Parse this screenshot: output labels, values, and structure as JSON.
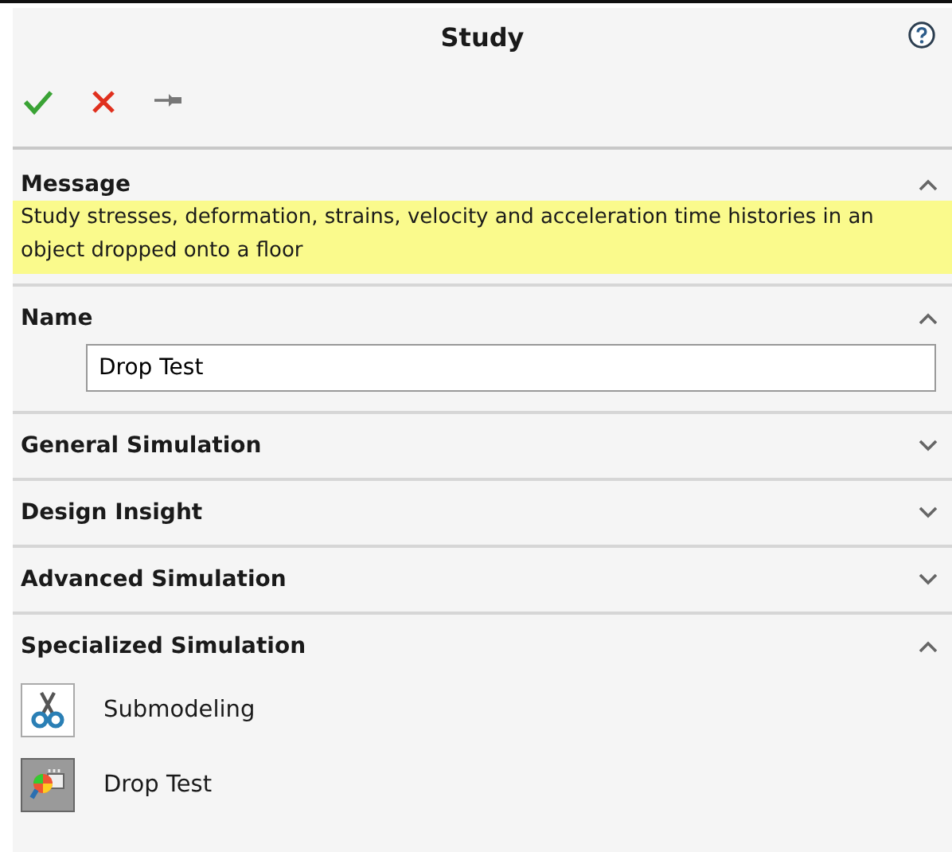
{
  "title": "Study",
  "toolbar": [
    {
      "kind": "ok"
    },
    {
      "kind": "cancel"
    },
    {
      "kind": "pin"
    }
  ],
  "sections": [
    {
      "title": "Message",
      "expanded": true,
      "kind": "message",
      "text": "Study stresses, deformation, strains, velocity and acceleration time histories in an object dropped onto a floor"
    },
    {
      "title": "Name",
      "expanded": true,
      "kind": "name",
      "value": "Drop Test"
    },
    {
      "title": "General Simulation",
      "expanded": false
    },
    {
      "title": "Design Insight",
      "expanded": false
    },
    {
      "title": "Advanced Simulation",
      "expanded": false
    },
    {
      "title": "Specialized Simulation",
      "expanded": true,
      "kind": "list",
      "items": [
        {
          "label": "Submodeling",
          "kind": "scissors",
          "selected": false
        },
        {
          "label": "Drop Test",
          "kind": "droptest",
          "selected": true
        }
      ]
    }
  ]
}
